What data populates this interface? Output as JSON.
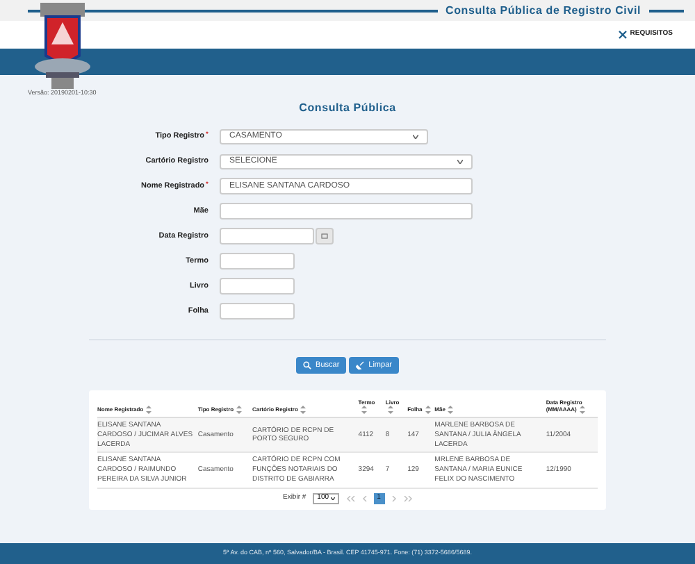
{
  "header": {
    "title": "Consulta Pública de Registro Civil",
    "link": "REQUISITOS",
    "version": "Versão: 20190201-10:30"
  },
  "form": {
    "title": "Consulta Pública",
    "required_mark": "*",
    "fields": [
      {
        "label": "Tipo Registro",
        "required": true,
        "kind": "select",
        "value": "CASAMENTO"
      },
      {
        "label": "Cartório Registro",
        "required": false,
        "kind": "select",
        "value": "SELECIONE"
      },
      {
        "label": "Nome Registrado",
        "required": true,
        "kind": "text",
        "value": "ELISANE SANTANA CARDOSO"
      },
      {
        "label": "Mãe",
        "required": false,
        "kind": "text"
      },
      {
        "label": "Data Registro",
        "required": false,
        "kind": "date"
      },
      {
        "label": "Termo",
        "required": false,
        "kind": "text"
      },
      {
        "label": "Livro",
        "required": false,
        "kind": "text"
      },
      {
        "label": "Folha",
        "required": false,
        "kind": "text"
      }
    ],
    "buttons": [
      "Buscar",
      "Limpar"
    ]
  },
  "table": {
    "columns": [
      "Nome Registrado",
      "Tipo Registro",
      "Cartório Registro",
      "Termo",
      "Livro",
      "Folha",
      "Mãe",
      "Data Registro (MM/AAAA)"
    ],
    "rows": [
      [
        "ELISANE SANTANA CARDOSO / JUCIMAR ALVES LACERDA",
        "Casamento",
        "CARTÓRIO DE RCPN DE PORTO SEGURO",
        "4112",
        "8",
        "147",
        "MARLENE BARBOSA DE SANTANA / JULIA ÂNGELA LACERDA",
        "11/2004"
      ],
      [
        "ELISANE SANTANA CARDOSO / RAIMUNDO PEREIRA DA SILVA JUNIOR",
        "Casamento",
        "CARTÓRIO DE RCPN COM FUNÇÕES NOTARIAIS DO DISTRITO DE GABIARRA",
        "3294",
        "7",
        "129",
        "MRLENE BARBOSA DE SANTANA / MARIA EUNICE FELIX DO NASCIMENTO",
        "12/1990"
      ]
    ]
  },
  "pagination": {
    "label": "Exibir #",
    "page_size": "100",
    "pages": [
      {
        "label": "1",
        "selected": true
      }
    ]
  },
  "footer": "5ª Av. do CAB, nº 560, Salvador/BA - Brasil. CEP 41745-971. Fone: (71) 3372-5686/5689."
}
